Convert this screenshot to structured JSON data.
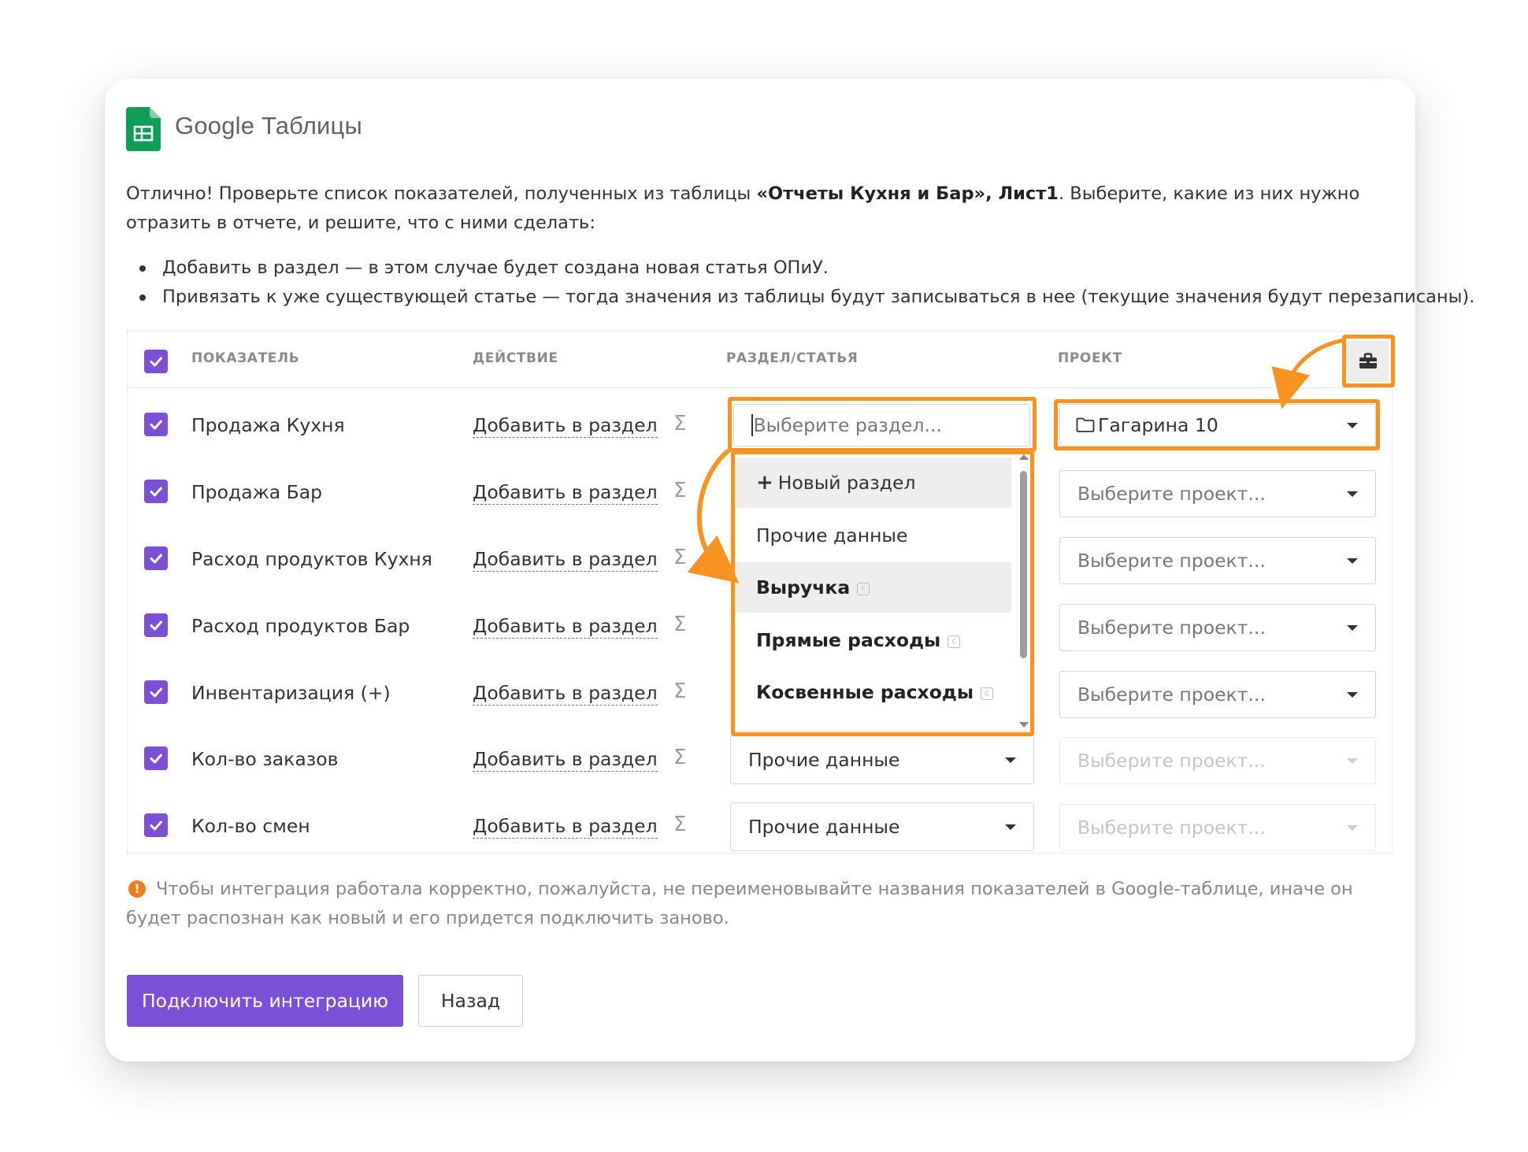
{
  "header": {
    "title": "Google Таблицы"
  },
  "intro": {
    "part1": "Отлично! Проверьте список показателей, полученных из таблицы ",
    "source": "«Отчеты Кухня и Бар», Лист1",
    "part2": ". Выберите, какие из них нужно отразить в отчете, и решите, что с ними сделать:"
  },
  "bullets": [
    "Добавить в раздел — в этом случае будет создана новая статья ОПиУ.",
    "Привязать к уже существующей статье — тогда значения из таблицы будут записываться в нее (текущие значения будут перезаписаны)."
  ],
  "table": {
    "headers": {
      "indicator": "ПОКАЗАТЕЛЬ",
      "action": "ДЕЙСТВИЕ",
      "section": "РАЗДЕЛ/СТАТЬЯ",
      "project": "ПРОЕКТ"
    },
    "sigma": "Σ",
    "rows": [
      {
        "name": "Продажа Кухня",
        "action": "Добавить в раздел",
        "section": "",
        "section_placeholder": "Выберите раздел...",
        "project": "Гагарина 10"
      },
      {
        "name": "Продажа Бар",
        "action": "Добавить в раздел",
        "project": "Выберите проект..."
      },
      {
        "name": "Расход продуктов Кухня",
        "action": "Добавить в раздел",
        "project": "Выберите проект..."
      },
      {
        "name": "Расход продуктов Бар",
        "action": "Добавить в раздел",
        "project": "Выберите проект..."
      },
      {
        "name": "Инвентаризация (+)",
        "action": "Добавить в раздел",
        "project": "Выберите проект..."
      },
      {
        "name": "Кол-во заказов",
        "action": "Добавить в раздел",
        "section": "Прочие данные",
        "project": "Выберите проект..."
      },
      {
        "name": "Кол-во смен",
        "action": "Добавить в раздел",
        "section": "Прочие данные",
        "project": "Выберите проект..."
      }
    ]
  },
  "dropdown": {
    "items": [
      {
        "label": "Новый раздел",
        "icon": "plus-icon"
      },
      {
        "label": "Прочие данные"
      },
      {
        "label": "Выручка",
        "icon": "copy-icon"
      },
      {
        "label": "Прямые расходы",
        "icon": "copy-icon"
      },
      {
        "label": "Косвенные расходы",
        "icon": "copy-icon"
      }
    ]
  },
  "footer": {
    "warning": "Чтобы интеграция работала корректно, пожалуйста, не переименовывайте названия показателей в Google-таблице, иначе он будет распознан как новый и его придется подключить заново.",
    "connect_label": "Подключить интеграцию",
    "back_label": "Назад"
  },
  "colors": {
    "accent": "#7b4fd6",
    "highlight": "#f7931e",
    "sheets_green": "#0f9d58",
    "warning": "#f47a1f"
  }
}
